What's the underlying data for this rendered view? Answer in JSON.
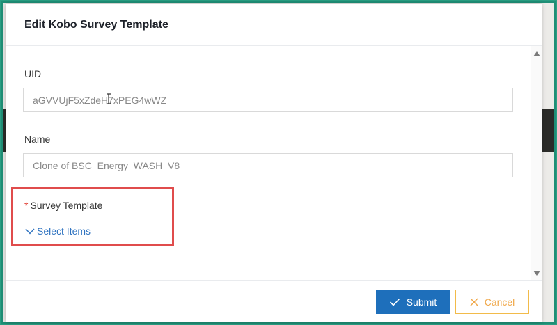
{
  "modal": {
    "title": "Edit Kobo Survey Template"
  },
  "form": {
    "uid": {
      "label": "UID",
      "value": "aGVVUjF5xZdeH7xPEG4wWZ"
    },
    "name": {
      "label": "Name",
      "value": "Clone of BSC_Energy_WASH_V8"
    },
    "survey_template": {
      "required_mark": "*",
      "label": "Survey Template",
      "select_label": "Select Items"
    }
  },
  "footer": {
    "submit_label": "Submit",
    "cancel_label": "Cancel"
  },
  "icons": {
    "submit": "check-icon",
    "cancel": "close-icon",
    "select": "chevron-down-icon",
    "scroll_up": "scroll-up-arrow-icon",
    "scroll_down": "scroll-down-arrow-icon"
  },
  "colors": {
    "primary": "#1e6fbb",
    "cancel": "#f0a84a",
    "required": "#e0362b",
    "link": "#2f73c0",
    "highlight": "#e04c4c"
  }
}
